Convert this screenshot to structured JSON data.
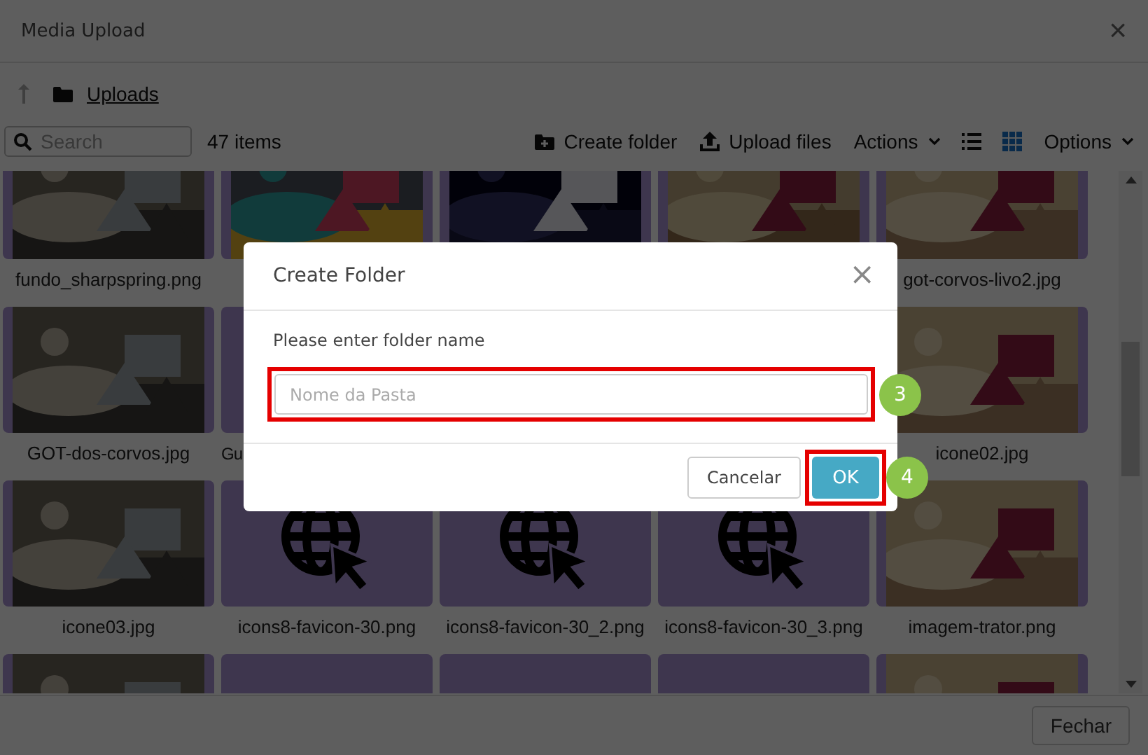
{
  "window": {
    "title": "Media Upload",
    "close": "×"
  },
  "breadcrumb": {
    "folder": "Uploads"
  },
  "toolbar": {
    "search_placeholder": "Search",
    "count": "47 items",
    "create_folder": "Create folder",
    "upload_files": "Upload files",
    "actions": "Actions",
    "options": "Options",
    "views": [
      {
        "kind": "list",
        "selected": false
      },
      {
        "kind": "grid",
        "selected": true
      }
    ]
  },
  "tiles": [
    {
      "kind": "picture",
      "label": "fundo_sharpspring.png"
    },
    {
      "kind": "picture"
    },
    {
      "kind": "picture"
    },
    {
      "kind": "picture"
    },
    {
      "kind": "picture",
      "label": "got-corvos-livo2.jpg"
    },
    {
      "kind": "picture",
      "label": "GOT-dos-corvos.jpg"
    },
    {
      "kind": "empty",
      "label": "Gu",
      "cut_off": true
    },
    {
      "kind": "covered"
    },
    {
      "kind": "covered"
    },
    {
      "kind": "picture",
      "label": "icone02.jpg"
    },
    {
      "kind": "picture",
      "label": "icone03.jpg"
    },
    {
      "kind": "globe",
      "label": "icons8-favicon-30.png"
    },
    {
      "kind": "globe",
      "label": "icons8-favicon-30_2.png"
    },
    {
      "kind": "globe",
      "label": "icons8-favicon-30_3.png"
    },
    {
      "kind": "picture",
      "label": "imagem-trator.png"
    },
    {
      "kind": "picture"
    },
    {
      "kind": "empty"
    },
    {
      "kind": "empty"
    },
    {
      "kind": "empty"
    },
    {
      "kind": "picture"
    }
  ],
  "footer": {
    "close_button": "Fechar"
  },
  "modal": {
    "title": "Create Folder",
    "close": "×",
    "prompt": "Please enter folder name",
    "placeholder": "Nome da Pasta",
    "cancel": "Cancelar",
    "ok": "OK"
  },
  "annotations": [
    {
      "label": "3"
    },
    {
      "label": "4"
    }
  ]
}
